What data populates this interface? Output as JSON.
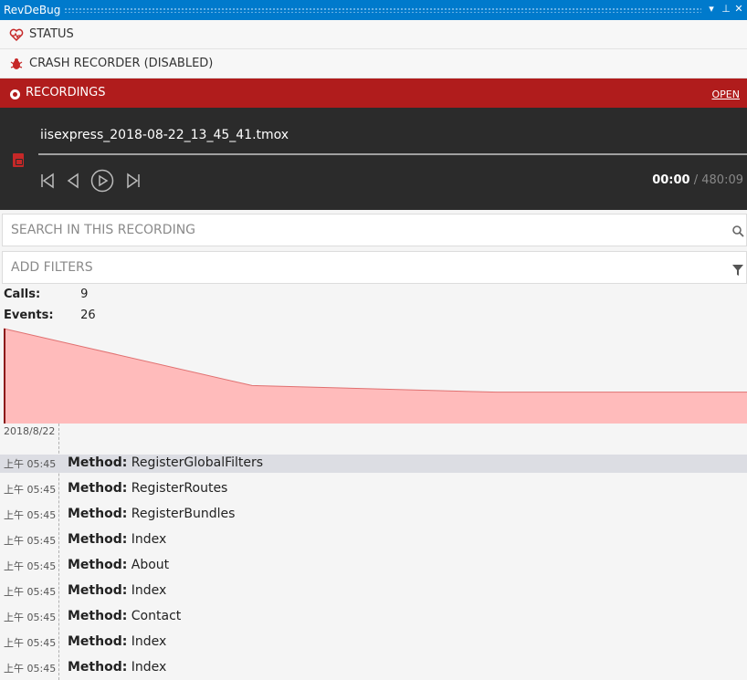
{
  "window": {
    "title": "RevDeBug",
    "dropdown_icon": "chevron-down-icon",
    "pin_icon": "pin-icon",
    "close_icon": "close-icon"
  },
  "sections": {
    "status": {
      "label": "STATUS",
      "icon": "heartbeat-icon"
    },
    "crash_recorder": {
      "label": "CRASH RECORDER (DISABLED)",
      "icon": "bug-icon"
    },
    "recordings": {
      "label": "RECORDINGS",
      "open_label": "OPEN",
      "icon": "record-icon"
    }
  },
  "player": {
    "file_name": "iisexpress_2018-08-22_13_45_41.tmox",
    "current_time": "00:00",
    "separator": "/",
    "total_time": "480:09"
  },
  "search": {
    "placeholder": "SEARCH IN THIS RECORDING"
  },
  "filters": {
    "placeholder": "ADD FILTERS"
  },
  "stats": {
    "calls_label": "Calls:",
    "calls_value": "9",
    "events_label": "Events:",
    "events_value": "26"
  },
  "chart_data": {
    "type": "area",
    "x": [
      0,
      1,
      2,
      3
    ],
    "y": [
      1.0,
      0.4,
      0.33,
      0.33
    ],
    "colors": {
      "fill": "#ffbbbb",
      "stroke": "#e07070"
    }
  },
  "timeline": {
    "date": "2018/8/22",
    "rows": [
      {
        "time": "上午 05:45",
        "kind": "Method:",
        "name": "RegisterGlobalFilters"
      },
      {
        "time": "上午 05:45",
        "kind": "Method:",
        "name": "RegisterRoutes"
      },
      {
        "time": "上午 05:45",
        "kind": "Method:",
        "name": "RegisterBundles"
      },
      {
        "time": "上午 05:45",
        "kind": "Method:",
        "name": "Index"
      },
      {
        "time": "上午 05:45",
        "kind": "Method:",
        "name": "About"
      },
      {
        "time": "上午 05:45",
        "kind": "Method:",
        "name": "Index"
      },
      {
        "time": "上午 05:45",
        "kind": "Method:",
        "name": "Contact"
      },
      {
        "time": "上午 05:45",
        "kind": "Method:",
        "name": "Index"
      },
      {
        "time": "上午 05:45",
        "kind": "Method:",
        "name": "Index"
      }
    ]
  },
  "colors": {
    "accent": "#007acc",
    "brand_red": "#b01c1c",
    "player_bg": "#2b2b2b"
  }
}
